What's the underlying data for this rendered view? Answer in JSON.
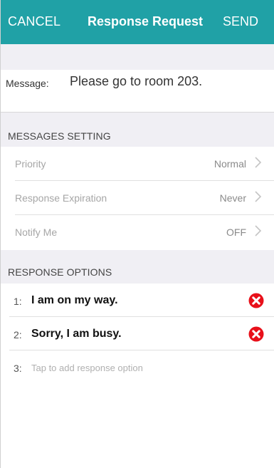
{
  "navbar": {
    "cancel_label": "CANCEL",
    "title": "Response Request",
    "send_label": "SEND",
    "background": "#20a1a6"
  },
  "message": {
    "label": "Message:",
    "text": "Please go to room 203."
  },
  "messages_setting": {
    "header": "MESSAGES SETTING",
    "rows": [
      {
        "label": "Priority",
        "value": "Normal",
        "icon": "chevron-right-icon"
      },
      {
        "label": "Response Expiration",
        "value": "Never",
        "icon": "chevron-right-icon"
      },
      {
        "label": "Notify Me",
        "value": "OFF",
        "icon": "chevron-right-icon"
      }
    ]
  },
  "response_options": {
    "header": "RESPONSE OPTIONS",
    "options": [
      {
        "number": "1:",
        "text": "I am on my way.",
        "icon": "delete-icon"
      },
      {
        "number": "2:",
        "text": "Sorry, I am busy.",
        "icon": "delete-icon"
      }
    ],
    "add_row": {
      "number": "3:",
      "placeholder": "Tap to add response option"
    },
    "delete_color": "#e8101a"
  }
}
